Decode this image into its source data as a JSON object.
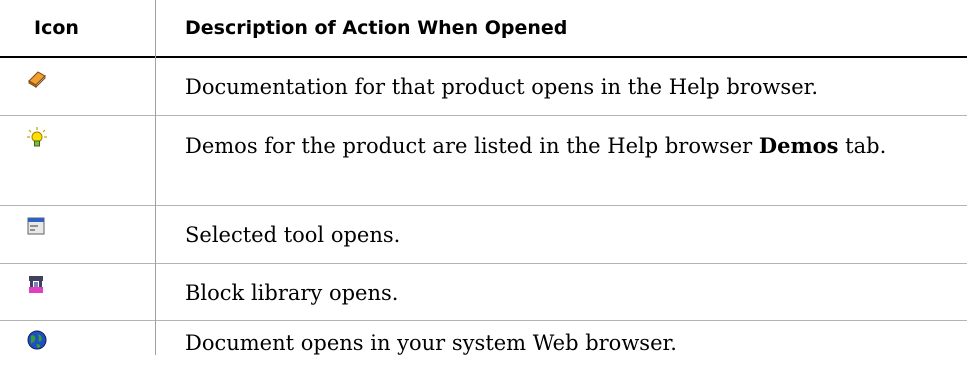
{
  "headers": {
    "icon": "Icon",
    "description": "Description of Action When Opened"
  },
  "rows": [
    {
      "icon": "book-icon",
      "text": "Documentation for that product opens in the Help browser."
    },
    {
      "icon": "lightbulb-icon",
      "text_before": "Demos for the product are listed in the Help browser ",
      "text_bold": "Demos",
      "text_after": " tab."
    },
    {
      "icon": "tool-window-icon",
      "text": "Selected tool opens."
    },
    {
      "icon": "block-library-icon",
      "text": "Block library opens."
    },
    {
      "icon": "globe-icon",
      "text": "Document opens in your system Web browser."
    }
  ]
}
